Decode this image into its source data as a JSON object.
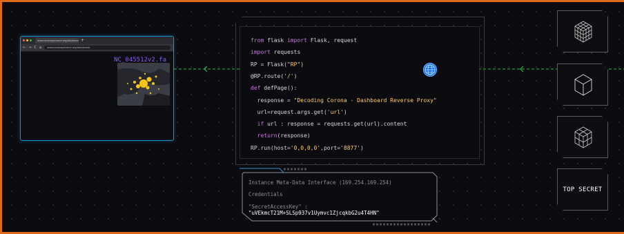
{
  "browser": {
    "tab_title": "www.coronagenome.org/dashboard",
    "tab_add": "+",
    "nav_back": "←",
    "nav_forward": "→",
    "nav_reload": "C",
    "nav_home": "⌂",
    "url": "www.coronagenome.org/dashboard",
    "filename": "NC_045512v2.fa"
  },
  "code": {
    "lines": [
      [
        {
          "t": "from",
          "k": "kw"
        },
        {
          "t": " flask "
        },
        {
          "t": "import",
          "k": "kw"
        },
        {
          "t": " Flask, request"
        }
      ],
      [
        {
          "t": "import",
          "k": "kw"
        },
        {
          "t": " requests"
        }
      ],
      [
        {
          "t": "RP = Flask("
        },
        {
          "t": "\"RP\"",
          "k": "str"
        },
        {
          "t": ")"
        }
      ],
      [
        {
          "t": "@RP.route("
        },
        {
          "t": "'/'",
          "k": "str"
        },
        {
          "t": ")"
        }
      ],
      [
        {
          "t": "def",
          "k": "kw"
        },
        {
          "t": " defPage():"
        }
      ],
      [
        {
          "t": "  response = "
        },
        {
          "t": "\"Decoding Corona - Dashboard Reverse Proxy\"",
          "k": "str"
        }
      ],
      [
        {
          "t": "  url=request.args.get("
        },
        {
          "t": "'url'",
          "k": "str"
        },
        {
          "t": ")"
        }
      ],
      [
        {
          "t": "  "
        },
        {
          "t": "if",
          "k": "kw"
        },
        {
          "t": " url : response = requests.get(url).content"
        }
      ],
      [
        {
          "t": "  "
        },
        {
          "t": "return",
          "k": "kw"
        },
        {
          "t": "(response)"
        }
      ],
      [
        {
          "t": "RP.run(host="
        },
        {
          "t": "'0,0,0,0'",
          "k": "str"
        },
        {
          "t": ",port="
        },
        {
          "t": "'8877'",
          "k": "str"
        },
        {
          "t": ")"
        }
      ]
    ]
  },
  "metadata_panel": {
    "title": "Instance Meta-Data Interface (169.254.169.254)",
    "credentials_label": "Credentials",
    "key_label": "\"SecretAccessKey\" :",
    "key_value": "\"uVEkmcT21M+SLSp937v1Uymvc1ZjcqkbG2u4T4HN\""
  },
  "side_panels": {
    "top_secret_label": "TOP SECRET"
  },
  "colors": {
    "frame_border": "#e06a1c",
    "connector": "#2fb84a",
    "browser_border": "#1f8fd0",
    "keyword": "#c678dd",
    "string": "#ffcb6b",
    "filename": "#8b5cf6"
  },
  "icons": [
    "cube-grid-icon",
    "cube-icon",
    "cube-stack-icon",
    "globe-icon"
  ]
}
